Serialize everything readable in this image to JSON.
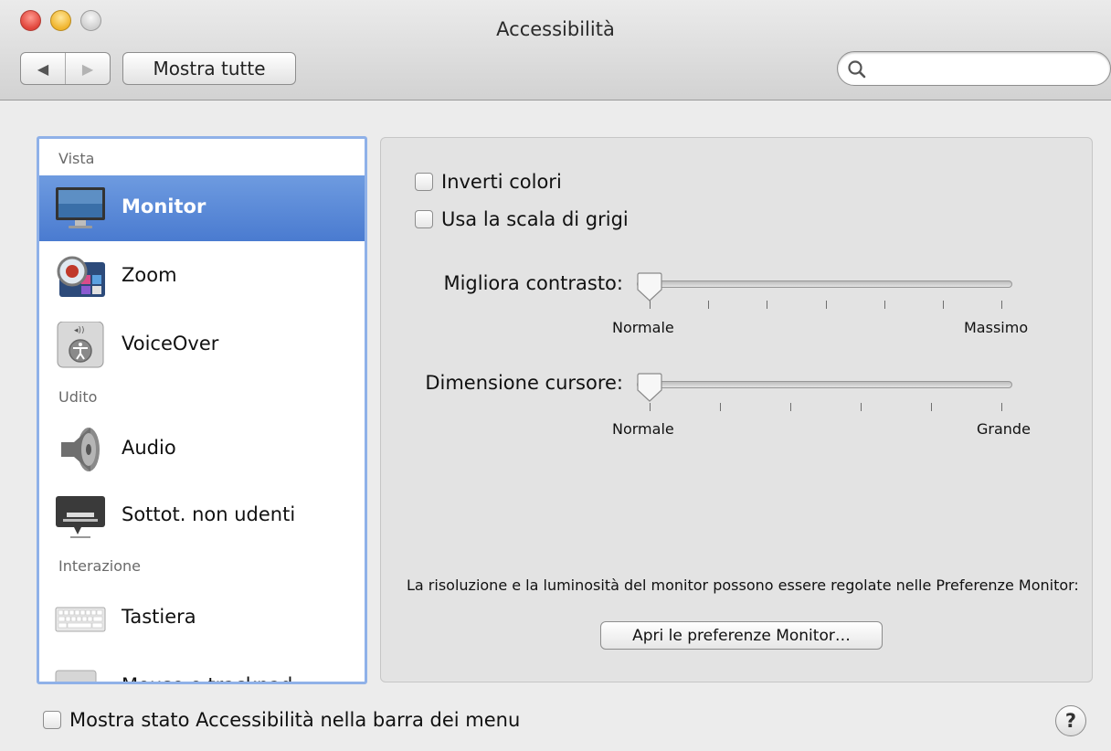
{
  "window": {
    "title": "Accessibilità"
  },
  "toolbar": {
    "back_icon": "◀",
    "forward_icon": "▶",
    "show_all_label": "Mostra tutte",
    "search_placeholder": "",
    "search_value": ""
  },
  "sidebar": {
    "sections": {
      "vista": "Vista",
      "udito": "Udito",
      "interazione": "Interazione"
    },
    "items": [
      {
        "label": "Monitor",
        "icon": "monitor-icon",
        "selected": true
      },
      {
        "label": "Zoom",
        "icon": "zoom-icon",
        "selected": false
      },
      {
        "label": "VoiceOver",
        "icon": "voiceover-icon",
        "selected": false
      },
      {
        "label": "Audio",
        "icon": "speaker-icon",
        "selected": false
      },
      {
        "label": "Sottot. non udenti",
        "icon": "captions-icon",
        "selected": false
      },
      {
        "label": "Tastiera",
        "icon": "keyboard-icon",
        "selected": false
      },
      {
        "label": "Mouse e trackpad",
        "icon": "mouse-icon",
        "selected": false
      }
    ]
  },
  "panel": {
    "invert_colors_label": "Inverti colori",
    "invert_colors_checked": false,
    "grayscale_label": "Usa la scala di grigi",
    "grayscale_checked": false,
    "contrast": {
      "label": "Migliora contrasto:",
      "min_label": "Normale",
      "max_label": "Massimo",
      "value": 0,
      "ticks": 7
    },
    "cursor": {
      "label": "Dimensione cursore:",
      "min_label": "Normale",
      "max_label": "Grande",
      "value": 0,
      "ticks": 6
    },
    "info_text": "La risoluzione e la luminosità del monitor possono essere regolate nelle Preferenze Monitor:",
    "open_prefs_label": "Apri le preferenze Monitor…"
  },
  "footer": {
    "menu_status_label": "Mostra stato Accessibilità nella barra dei menu",
    "menu_status_checked": false,
    "help_label": "?"
  },
  "colors": {
    "selection": "#4a7bd0",
    "sidebar_border": "#8fb1e8"
  }
}
